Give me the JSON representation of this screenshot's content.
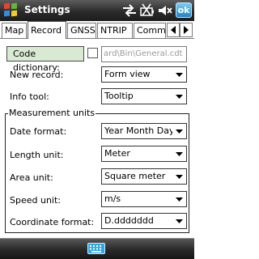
{
  "titlebar": {
    "title": "Settings",
    "ok_label": "ok"
  },
  "tabs": [
    {
      "label": "Map"
    },
    {
      "label": "Record"
    },
    {
      "label": "GNSS"
    },
    {
      "label": "NTRIP"
    },
    {
      "label": "Commar"
    }
  ],
  "form": {
    "code_dictionary": {
      "button_label": "Code dictionary:",
      "path_value": "ard\\Bin\\General.cdt"
    },
    "new_record": {
      "label": "New record:",
      "value": "Form view"
    },
    "info_tool": {
      "label": "Info tool:",
      "value": "Tooltip"
    },
    "measurement_units": {
      "title": "Measurement units",
      "date_format": {
        "label": "Date format:",
        "value": "Year Month Day"
      },
      "length_unit": {
        "label": "Length unit:",
        "value": "Meter"
      },
      "area_unit": {
        "label": "Area unit:",
        "value": "Square meter"
      },
      "speed_unit": {
        "label": "Speed unit:",
        "value": "m/s"
      },
      "coordinate_format": {
        "label": "Coordinate format:",
        "value": "D.ddddddd"
      }
    }
  },
  "colors": {
    "title_bar": "#2b2b2b",
    "ok_button": "#1e86c6",
    "code_button_bg": "#d9ead3"
  },
  "icons": [
    "windows-logo-icon",
    "connectivity-icon",
    "battery-charging-icon",
    "volume-muted-icon",
    "scroll-left-icon",
    "scroll-right-icon",
    "keyboard-icon",
    "dropdown-arrow-icon"
  ]
}
